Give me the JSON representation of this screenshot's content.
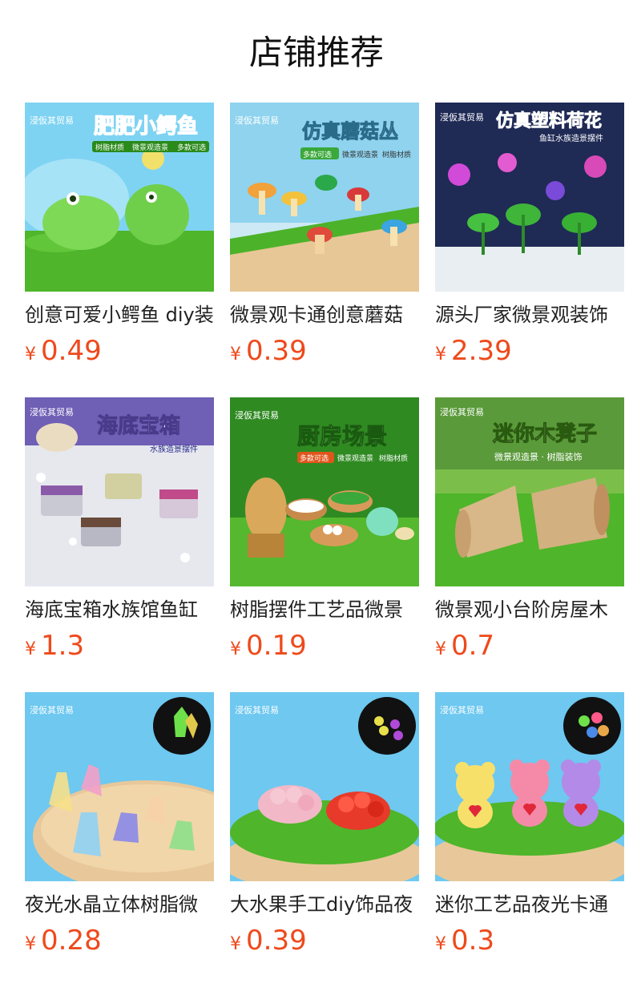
{
  "header": {
    "title": "店铺推荐"
  },
  "products": [
    {
      "name": "创意可爱小鳄鱼 diy装",
      "currency": "¥",
      "price": "0.49",
      "image": {
        "brand": "浸仮其贸易",
        "banner": "肥肥小鳄鱼",
        "tags": [
          "树脂材质",
          "微景观造景",
          "多款可选"
        ]
      }
    },
    {
      "name": "微景观卡通创意蘑菇",
      "currency": "¥",
      "price": "0.39",
      "image": {
        "brand": "浸仮其贸易",
        "banner": "仿真蘑菇丛",
        "badge": "多款可选",
        "tags": [
          "微景观造景",
          "树脂材质"
        ]
      }
    },
    {
      "name": "源头厂家微景观装饰",
      "currency": "¥",
      "price": "2.39",
      "image": {
        "brand": "浸仮其贸易",
        "banner": "仿真塑料荷花",
        "subtitle": "鱼缸水族造景摆件"
      }
    },
    {
      "name": "海底宝箱水族馆鱼缸",
      "currency": "¥",
      "price": "1.3",
      "image": {
        "brand": "浸仮其贸易",
        "banner": "海底宝箱",
        "subtitle": "水族造景摆件"
      }
    },
    {
      "name": "树脂摆件工艺品微景",
      "currency": "¥",
      "price": "0.19",
      "image": {
        "brand": "浸仮其贸易",
        "banner": "厨房场景",
        "badge": "多款可选",
        "tags": [
          "微景观造景",
          "树脂材质"
        ]
      }
    },
    {
      "name": "微景观小台阶房屋木",
      "currency": "¥",
      "price": "0.7",
      "image": {
        "brand": "浸仮其贸易",
        "banner": "迷你木凳子",
        "subtitle": "微景观造景 · 树脂装饰"
      }
    },
    {
      "name": "夜光水晶立体树脂微",
      "currency": "¥",
      "price": "0.28",
      "image": {
        "brand": "浸仮其贸易"
      }
    },
    {
      "name": "大水果手工diy饰品夜",
      "currency": "¥",
      "price": "0.39",
      "image": {
        "brand": "浸仮其贸易"
      }
    },
    {
      "name": "迷你工艺品夜光卡通",
      "currency": "¥",
      "price": "0.3",
      "image": {
        "brand": "浸仮其贸易"
      }
    }
  ],
  "colors": {
    "price": "#ee4a1c",
    "text": "#222222",
    "grass": "#4fb52a",
    "sky": "#6fc5ef"
  }
}
